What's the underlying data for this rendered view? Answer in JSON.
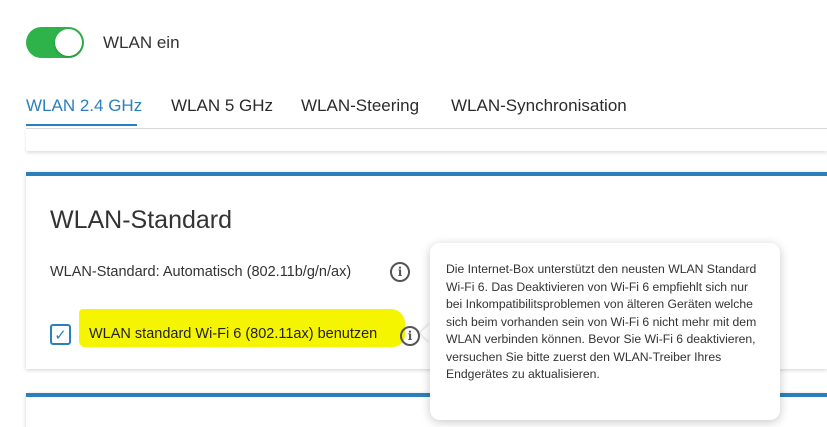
{
  "toggle": {
    "label": "WLAN ein",
    "state": "on",
    "color": "#2eb34a"
  },
  "tabs": [
    {
      "label": "WLAN 2.4 GHz",
      "active": true
    },
    {
      "label": "WLAN 5 GHz",
      "active": false
    },
    {
      "label": "WLAN-Steering",
      "active": false
    },
    {
      "label": "WLAN-Synchronisation",
      "active": false
    }
  ],
  "card": {
    "title": "WLAN-Standard",
    "standard_text": "WLAN-Standard: Automatisch (802.11b/g/n/ax)",
    "checkbox_label": "WLAN standard Wi-Fi 6 (802.11ax) benutzen",
    "checkbox_checked": true
  },
  "tooltip": {
    "text": "Die Internet-Box unterstützt den neusten WLAN Standard Wi-Fi 6. Das Deaktivieren von Wi-Fi 6 empfiehlt sich nur bei Inkompatibilitsproblemen von älteren Geräten welche sich beim vorhanden sein von Wi-Fi 6 nicht mehr mit dem WLAN verbinden können. Bevor Sie Wi-Fi 6 deaktivieren, versuchen Sie bitte zuerst den WLAN-Treiber Ihres Endgerätes zu aktualisieren."
  },
  "colors": {
    "accent": "#2b7fbd",
    "highlight": "#f5f500"
  },
  "icons": {
    "info": "info-icon",
    "check": "check-icon"
  }
}
